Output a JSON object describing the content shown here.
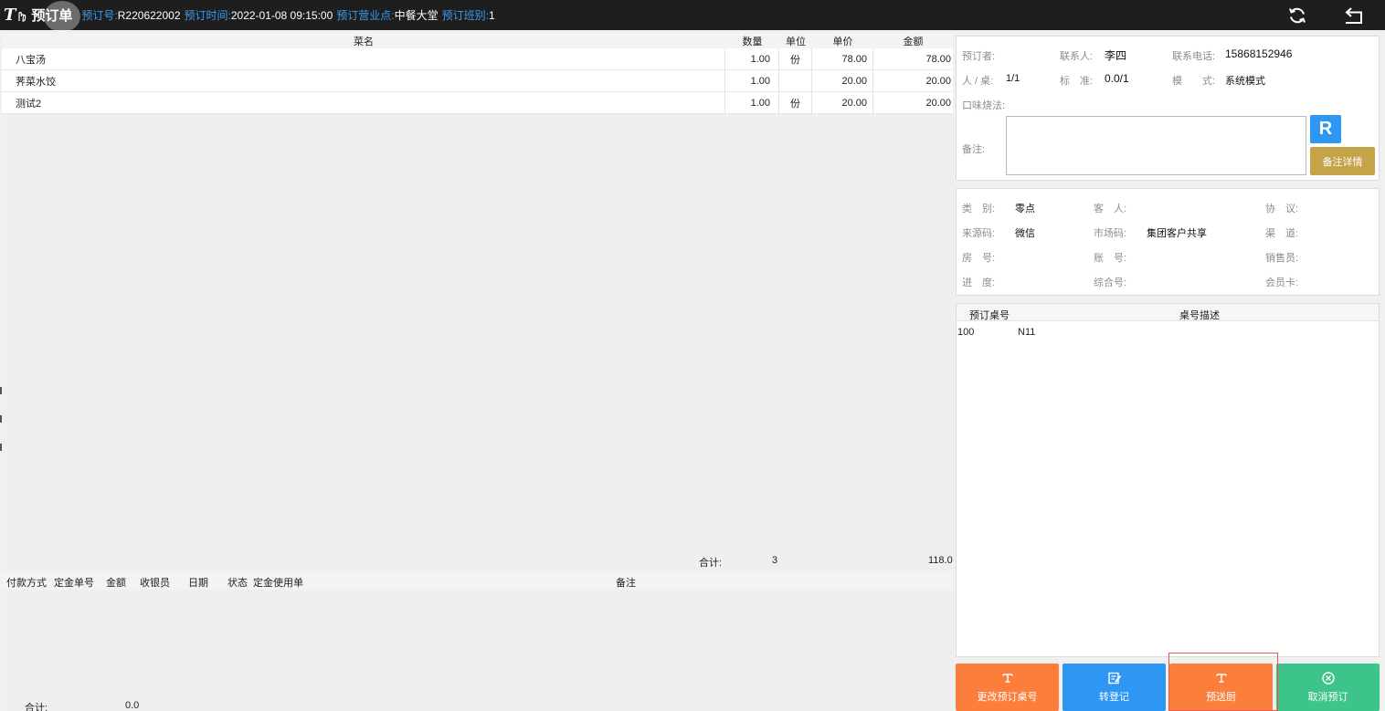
{
  "header": {
    "logo_text": "T",
    "title": "预订单",
    "order_no_label": "预订号:",
    "order_no": "R220622002",
    "time_label": "预订时间:",
    "time": "2022-01-08 09:15:00",
    "outlet_label": "预订营业点:",
    "outlet": "中餐大堂",
    "shift_label": "预订班别:",
    "shift": "1",
    "icons": [
      "refresh-icon",
      "back-icon"
    ]
  },
  "dishes": {
    "columns": [
      "菜名",
      "数量",
      "单位",
      "单价",
      "金额"
    ],
    "rows": [
      {
        "name": "八宝汤",
        "qty": "1.00",
        "unit": "份",
        "price": "78.00",
        "amount": "78.00"
      },
      {
        "name": "荠菜水饺",
        "qty": "1.00",
        "unit": "",
        "price": "20.00",
        "amount": "20.00"
      },
      {
        "name": "测试2",
        "qty": "1.00",
        "unit": "份",
        "price": "20.00",
        "amount": "20.00"
      }
    ],
    "total_label": "合计:",
    "total_qty": "3",
    "total_amount": "118.0"
  },
  "payments": {
    "columns": [
      "付款方式",
      "定金单号",
      "金额",
      "收银员",
      "日期",
      "状态",
      "定金使用单",
      "备注"
    ],
    "total_label": "合计:",
    "total_amount": "0.0"
  },
  "booker": {
    "booker_label": "预订者:",
    "booker": "",
    "contact_label": "联系人:",
    "contact": "李四",
    "phone_label": "联系电话:",
    "phone": "15868152946",
    "people_label": "人 / 桌:",
    "people": "1/1",
    "standard_label": "标　准:",
    "standard": "0.0/1",
    "mode_label": "模　　式:",
    "mode": "系统模式",
    "taste_label": "口味烧法:",
    "remark_label": "备注:",
    "remark_value": "",
    "r_button": "R",
    "remark_detail_button": "备注详情"
  },
  "details": {
    "category_label": "类　别:",
    "category": "零点",
    "guest_label": "客　人:",
    "guest": "",
    "agreement_label": "协　议:",
    "agreement": "",
    "source_label": "来源码:",
    "source": "微信",
    "market_label": "市场码:",
    "market": "集团客户共享",
    "channel_label": "渠　道:",
    "channel": "",
    "room_label": "房　号:",
    "room": "",
    "account_label": "账　号:",
    "account": "",
    "sales_label": "销售员:",
    "sales": "",
    "progress_label": "进　度:",
    "progress": "",
    "composite_label": "综合号:",
    "composite": "",
    "member_label": "会员卡:",
    "member": ""
  },
  "tables": {
    "columns": [
      "预订桌号",
      "桌号描述"
    ],
    "rows": [
      {
        "no": "100",
        "desc": "N11"
      }
    ]
  },
  "actions": {
    "change_table": "更改预订桌号",
    "transfer": "转登记",
    "send_kitchen": "预送厨",
    "cancel": "取消预订"
  },
  "colors": {
    "header_bg": "#1e1e1e",
    "label_blue": "#3b9cf0",
    "orange": "#fb7e3c",
    "blue": "#2e96f3",
    "green": "#3dc48a",
    "gold": "#c5a348"
  }
}
